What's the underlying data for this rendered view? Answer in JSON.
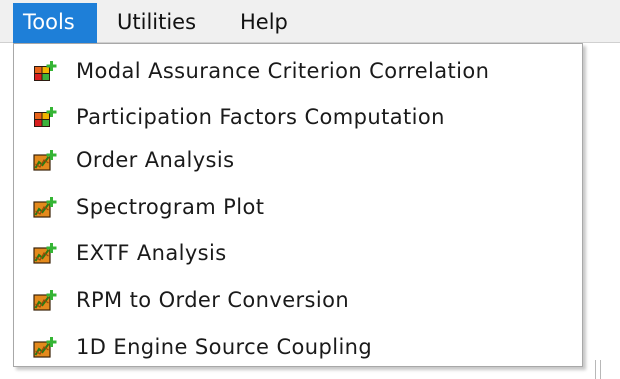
{
  "menubar": {
    "items": [
      {
        "label": "Tools",
        "active": true
      },
      {
        "label": "Utilities",
        "active": false
      },
      {
        "label": "Help",
        "active": false
      }
    ]
  },
  "colors": {
    "menubar_bg": "#f0f0f0",
    "active_menu_bg": "#1e7fd8",
    "menu_bg": "#ffffff",
    "text": "#1a1a1a"
  },
  "tools_menu": {
    "items": [
      {
        "label": "Modal Assurance Criterion Correlation",
        "icon": "grid-add-icon"
      },
      {
        "label": "Participation Factors Computation",
        "icon": "grid-add-icon"
      },
      {
        "label": "Order Analysis",
        "icon": "chart-add-icon"
      },
      {
        "label": "Spectrogram Plot",
        "icon": "chart-add-icon"
      },
      {
        "label": "EXTF Analysis",
        "icon": "chart-add-icon"
      },
      {
        "label": "RPM to Order Conversion",
        "icon": "chart-add-icon"
      },
      {
        "label": "1D Engine Source Coupling",
        "icon": "chart-add-icon"
      }
    ]
  }
}
